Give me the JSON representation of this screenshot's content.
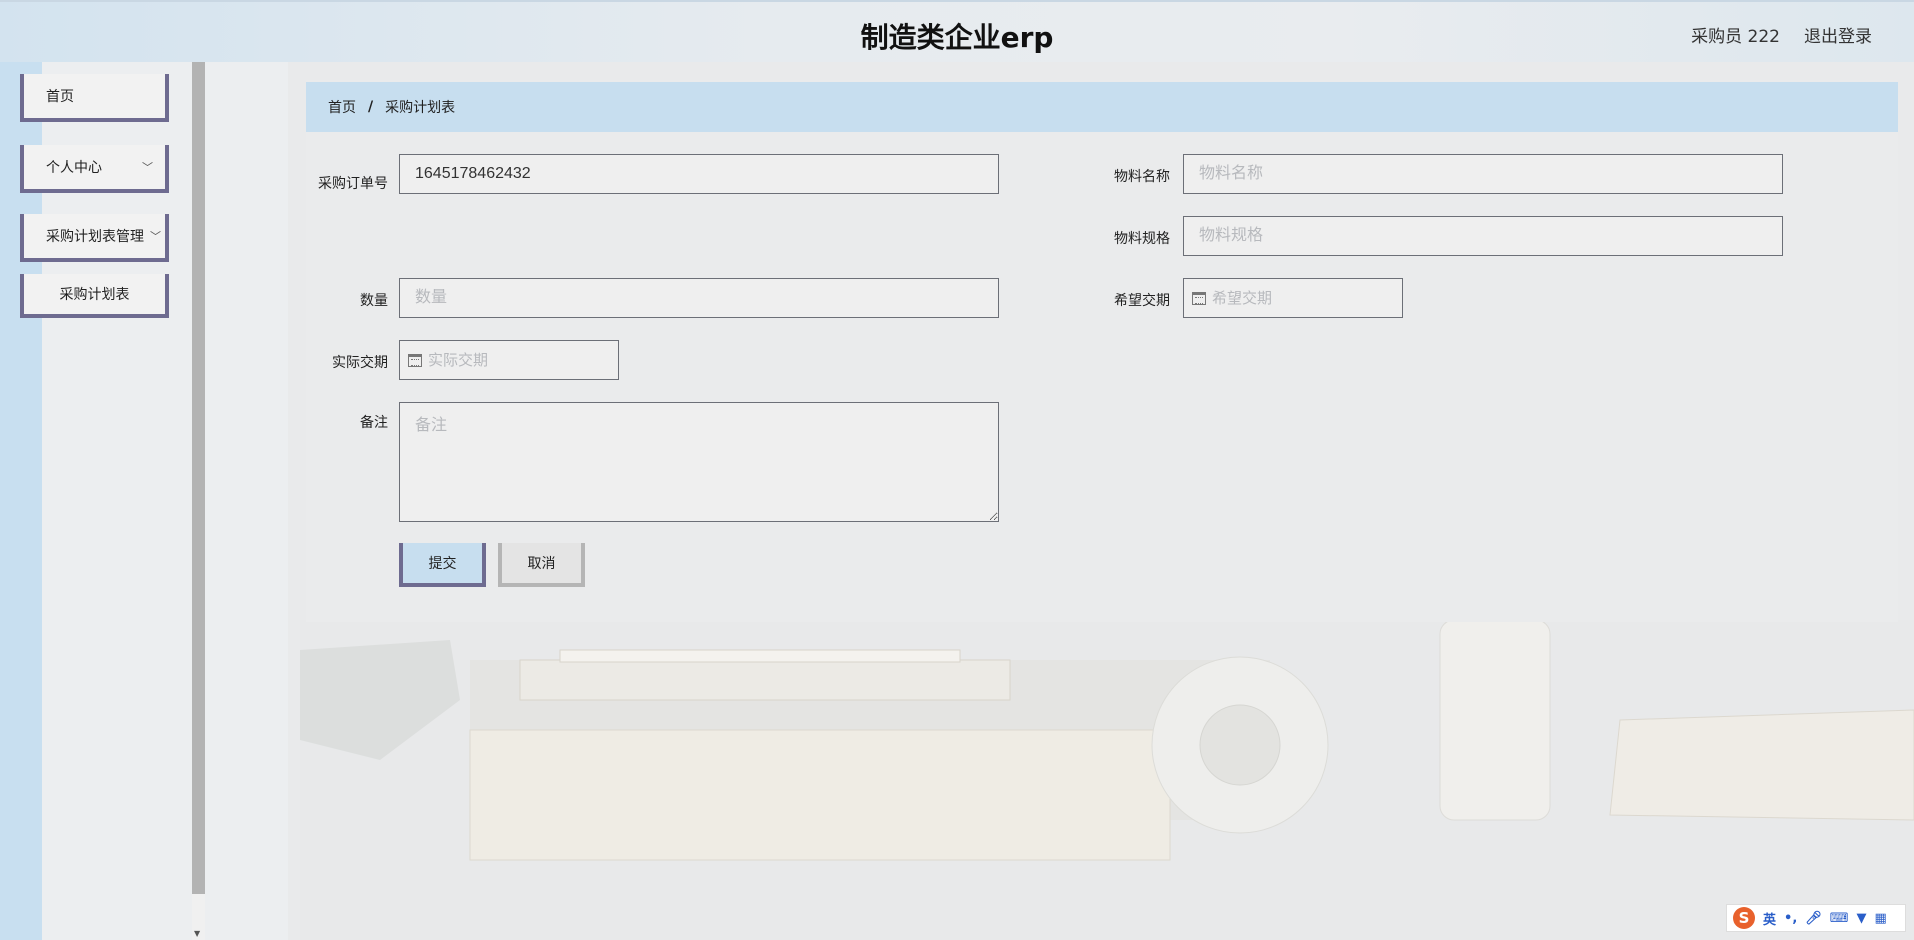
{
  "header": {
    "title": "制造类企业erp",
    "user": "采购员 222",
    "logout": "退出登录"
  },
  "sidebar": {
    "items": [
      {
        "label": "首页"
      },
      {
        "label": "个人中心"
      },
      {
        "label": "采购计划表管理"
      },
      {
        "label": "采购计划表"
      }
    ]
  },
  "breadcrumb": {
    "home": "首页",
    "separator": "/",
    "current": "采购计划表"
  },
  "form": {
    "order_no_label": "采购订单号",
    "order_no_value": "1645178462432",
    "material_name_label": "物料名称",
    "material_name_placeholder": "物料名称",
    "material_spec_label": "物料规格",
    "material_spec_placeholder": "物料规格",
    "quantity_label": "数量",
    "quantity_placeholder": "数量",
    "expected_date_label": "希望交期",
    "expected_date_placeholder": "希望交期",
    "actual_date_label": "实际交期",
    "actual_date_placeholder": "实际交期",
    "remark_label": "备注",
    "remark_placeholder": "备注",
    "submit": "提交",
    "cancel": "取消"
  },
  "ime": {
    "lang": "英",
    "punct": "•,"
  },
  "colors": {
    "accent_blue": "#c7deef",
    "menu_border": "#6e6b90"
  }
}
